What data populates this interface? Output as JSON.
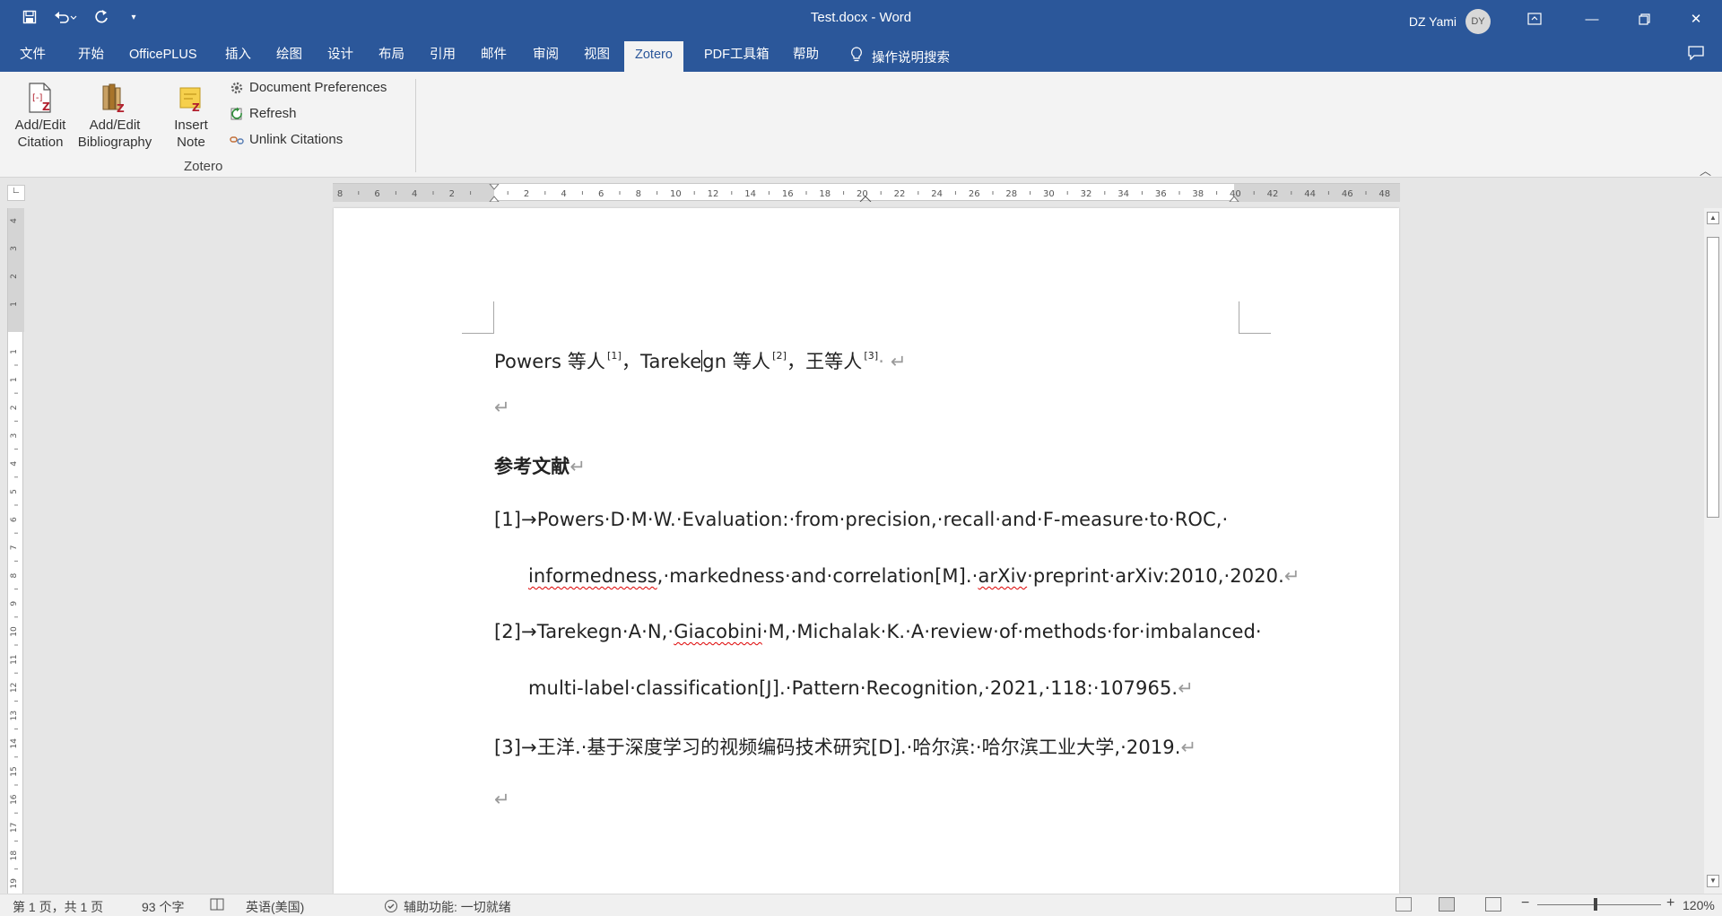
{
  "titlebar": {
    "title": "Test.docx  -  Word",
    "user_name": "DZ Yami",
    "avatar_initials": "DY"
  },
  "tabs": [
    "文件",
    "开始",
    "OfficePLUS",
    "插入",
    "绘图",
    "设计",
    "布局",
    "引用",
    "邮件",
    "审阅",
    "视图",
    "Zotero",
    "PDF工具箱",
    "帮助"
  ],
  "active_tab": "Zotero",
  "tell_me": "操作说明搜索",
  "ribbon": {
    "add_edit_citation": [
      "Add/Edit",
      "Citation"
    ],
    "add_edit_bibliography": [
      "Add/Edit",
      "Bibliography"
    ],
    "insert_note": [
      "Insert",
      "Note"
    ],
    "document_preferences": "Document Preferences",
    "refresh": "Refresh",
    "unlink_citations": "Unlink Citations",
    "group_label": "Zotero"
  },
  "ruler": {
    "h_ticks": [
      "8",
      "6",
      "4",
      "2",
      "",
      "2",
      "4",
      "6",
      "8",
      "10",
      "12",
      "14",
      "16",
      "18",
      "20",
      "22",
      "24",
      "26",
      "28",
      "30",
      "32",
      "34",
      "36",
      "38",
      "40",
      "42",
      "44",
      "46",
      "48"
    ],
    "v_ticks_top": [
      "4",
      "3",
      "2",
      "1"
    ],
    "v_ticks": [
      "1",
      "1",
      "2",
      "3",
      "4",
      "5",
      "6",
      "7",
      "8",
      "9",
      "10",
      "11",
      "12",
      "13",
      "14",
      "15",
      "16",
      "17",
      "18",
      "19"
    ]
  },
  "document": {
    "line1": {
      "a": "Powers 等人",
      "sup1": "[1]",
      "b": "，Tareke",
      "c": "gn 等人",
      "sup2": "[2]",
      "d": "，王等人",
      "sup3": "[3]",
      "e": "·",
      "mark": "↵"
    },
    "empty_mark": "↵",
    "heading": "参考文献",
    "heading_mark": "↵",
    "ref1_line1": "[1]→Powers·D·M·W.·Evaluation:·from·precision,·recall·and·F-measure·to·ROC,·",
    "ref1_line2_a": "informedness",
    "ref1_line2_b": ",·markedness·and·correlation[M].·",
    "ref1_line2_c": "arXiv",
    "ref1_line2_d": "·preprint·arXiv:2010,·2020.",
    "ref2_line1_a": "[2]→Tarekegn·A·N,·",
    "ref2_line1_b": "Giacobini",
    "ref2_line1_c": "·M,·Michalak·K.·A·review·of·methods·for·imbalanced·",
    "ref2_line2": "multi-label·classification[J].·Pattern·Recognition,·2021,·118:·107965.",
    "ref3_line1": "[3]→王洋.·基于深度学习的视频编码技术研究[D].·哈尔滨:·哈尔滨工业大学,·2019.",
    "para_mark": "↵"
  },
  "statusbar": {
    "page": "第 1 页，共 1 页",
    "words": "93 个字",
    "language": "英语(美国)",
    "accessibility": "辅助功能: 一切就绪",
    "zoom": "120%"
  }
}
